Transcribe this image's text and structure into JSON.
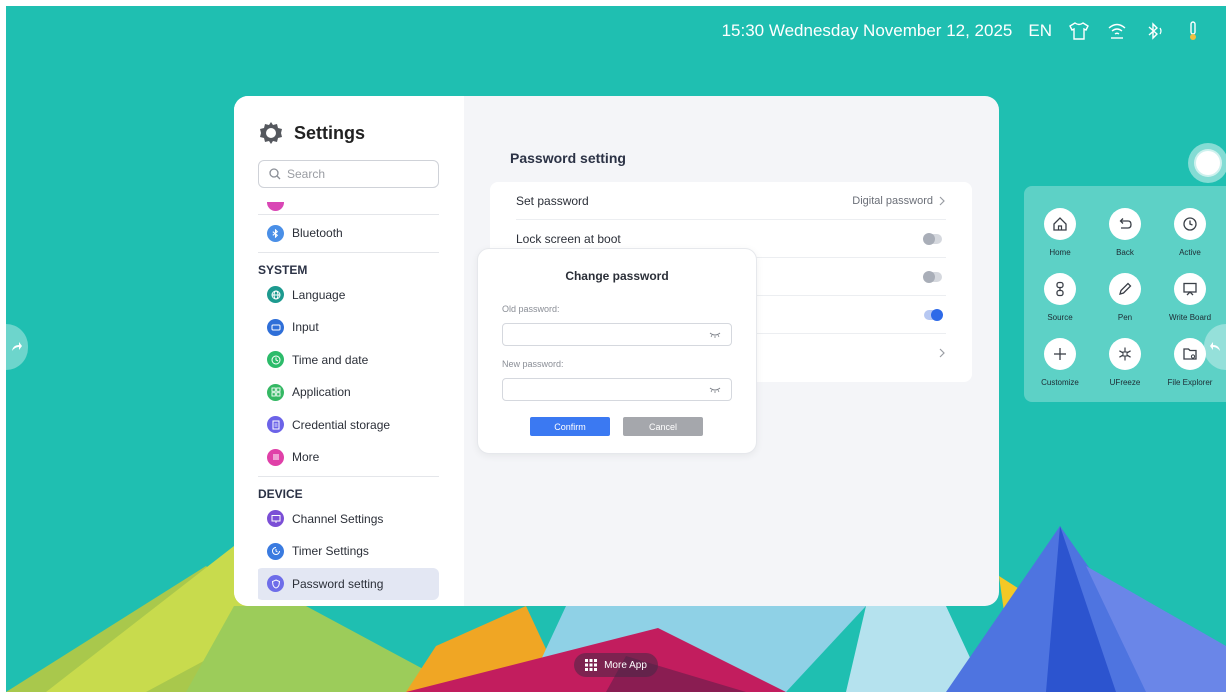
{
  "status_bar": {
    "datetime": "15:30 Wednesday November 12, 2025",
    "language": "EN",
    "icons": [
      "shirt-icon",
      "wifi-icon",
      "bluetooth-icon",
      "thermometer-icon"
    ]
  },
  "settings": {
    "title": "Settings",
    "search_placeholder": "Search",
    "sidebar": {
      "items_top": [
        {
          "label": "Bluetooth",
          "icon": "bluetooth-icon",
          "color": "#4a8fe7"
        }
      ],
      "system_header": "SYSTEM",
      "system_items": [
        {
          "label": "Language",
          "icon": "globe-icon",
          "color": "#1d9a8f"
        },
        {
          "label": "Input",
          "icon": "keyboard-icon",
          "color": "#2f6fd8"
        },
        {
          "label": "Time and date",
          "icon": "clock-icon",
          "color": "#2cbb6a"
        },
        {
          "label": "Application",
          "icon": "apps-icon",
          "color": "#35b864"
        },
        {
          "label": "Credential storage",
          "icon": "document-icon",
          "color": "#6c63e8"
        },
        {
          "label": "More",
          "icon": "menu-icon",
          "color": "#e040a8"
        }
      ],
      "device_header": "DEVICE",
      "device_items": [
        {
          "label": "Channel Settings",
          "icon": "monitor-icon",
          "color": "#7b4fd6"
        },
        {
          "label": "Timer Settings",
          "icon": "timer-icon",
          "color": "#3a7be0"
        },
        {
          "label": "Password setting",
          "icon": "shield-icon",
          "color": "#6e6de9",
          "active": true
        }
      ]
    },
    "content": {
      "title": "Password setting",
      "rows": [
        {
          "label": "Set password",
          "value": "Digital password",
          "type": "link"
        },
        {
          "label": "Lock screen at boot",
          "type": "toggle",
          "on": false
        },
        {
          "label": "",
          "type": "toggle",
          "on": false
        },
        {
          "label": "",
          "type": "toggle",
          "on": true
        },
        {
          "label": "",
          "type": "link",
          "value": ""
        }
      ]
    }
  },
  "dialog": {
    "title": "Change password",
    "old_label": "Old password:",
    "old_value": "",
    "new_label": "New password:",
    "new_value": "",
    "confirm": "Confirm",
    "cancel": "Cancel"
  },
  "quick_panel": {
    "items": [
      {
        "label": "Home",
        "icon": "home-icon"
      },
      {
        "label": "Back",
        "icon": "back-icon"
      },
      {
        "label": "Active",
        "icon": "clock-icon"
      },
      {
        "label": "Source",
        "icon": "source-icon"
      },
      {
        "label": "Pen",
        "icon": "pen-icon"
      },
      {
        "label": "Write Board",
        "icon": "whiteboard-icon"
      },
      {
        "label": "Customize",
        "icon": "plus-icon"
      },
      {
        "label": "UFreeze",
        "icon": "snowflake-icon"
      },
      {
        "label": "File Explorer",
        "icon": "folder-icon"
      }
    ]
  },
  "dock": {
    "more_app": "More App"
  },
  "colors": {
    "background": "#1fbfb1",
    "accent": "#3b79f2",
    "toggle_on": "#2e6ae8"
  }
}
